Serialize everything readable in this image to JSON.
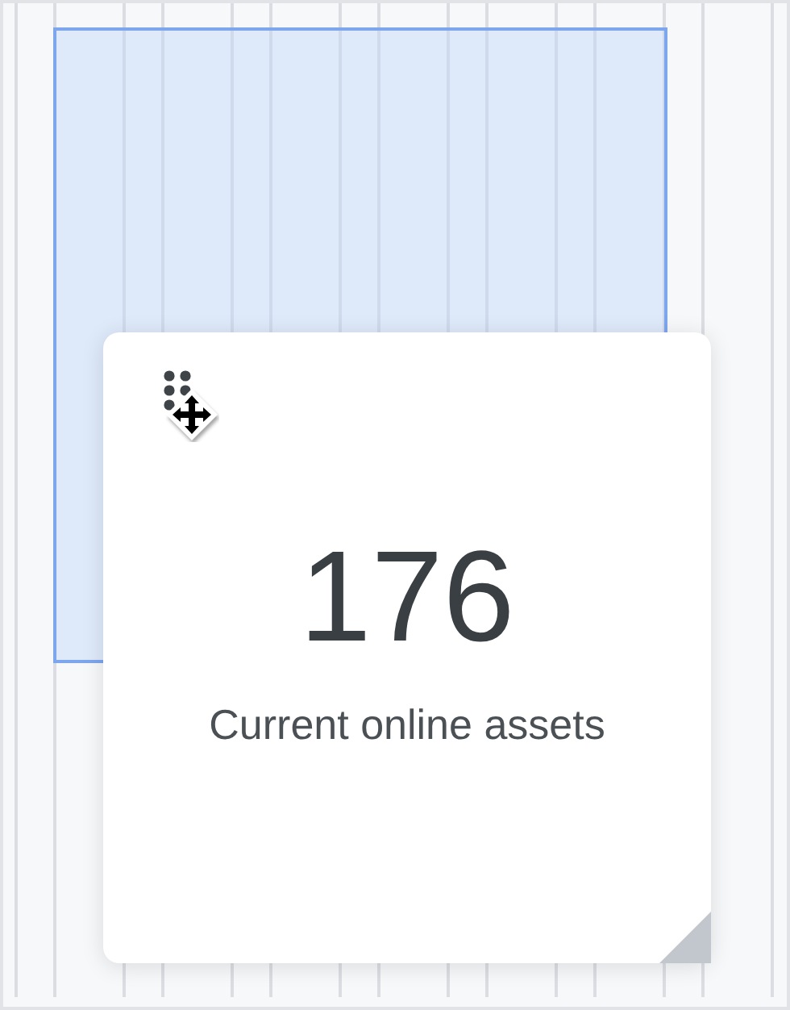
{
  "widget": {
    "value": "176",
    "label": "Current online assets",
    "dragging": true
  }
}
